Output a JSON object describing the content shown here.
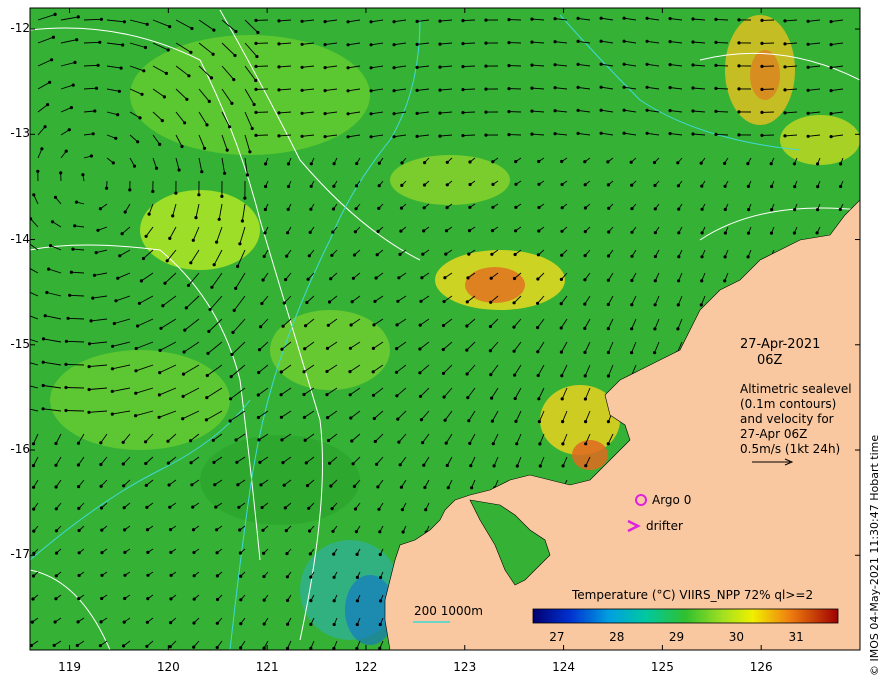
{
  "map": {
    "lat_ticks": [
      "-12",
      "-13",
      "-14",
      "-15",
      "-16",
      "-17"
    ],
    "lon_ticks": [
      "119",
      "120",
      "121",
      "122",
      "123",
      "124",
      "125",
      "126"
    ],
    "lat_range": [
      -17.9,
      -11.8
    ],
    "lon_range": [
      118.6,
      127.0
    ],
    "colors": {
      "land": "#f9c8a0",
      "contour": "#ffffff",
      "isobath": "#40d8d8",
      "argo": "#e020e0",
      "arrow": "#000000"
    }
  },
  "info": {
    "date": "27-Apr-2021",
    "hour": "06Z",
    "desc_lines": [
      "Altimetric sealevel",
      "(0.1m contours)",
      "and velocity for",
      "27-Apr 06Z",
      "0.5m/s (1kt 24h)"
    ]
  },
  "markers": {
    "argo_label": "Argo 0",
    "drifter_label": "drifter"
  },
  "bathy_legend": {
    "label": "200  1000m"
  },
  "colorbar": {
    "title": "Temperature (°C) VIIRS_NPP 72% ql>=2",
    "ticks": [
      "27",
      "28",
      "29",
      "30",
      "31"
    ],
    "range": [
      26.6,
      31.7
    ]
  },
  "credit": "© IMOS 04-May-2021 11:30:47 Hobart time"
}
